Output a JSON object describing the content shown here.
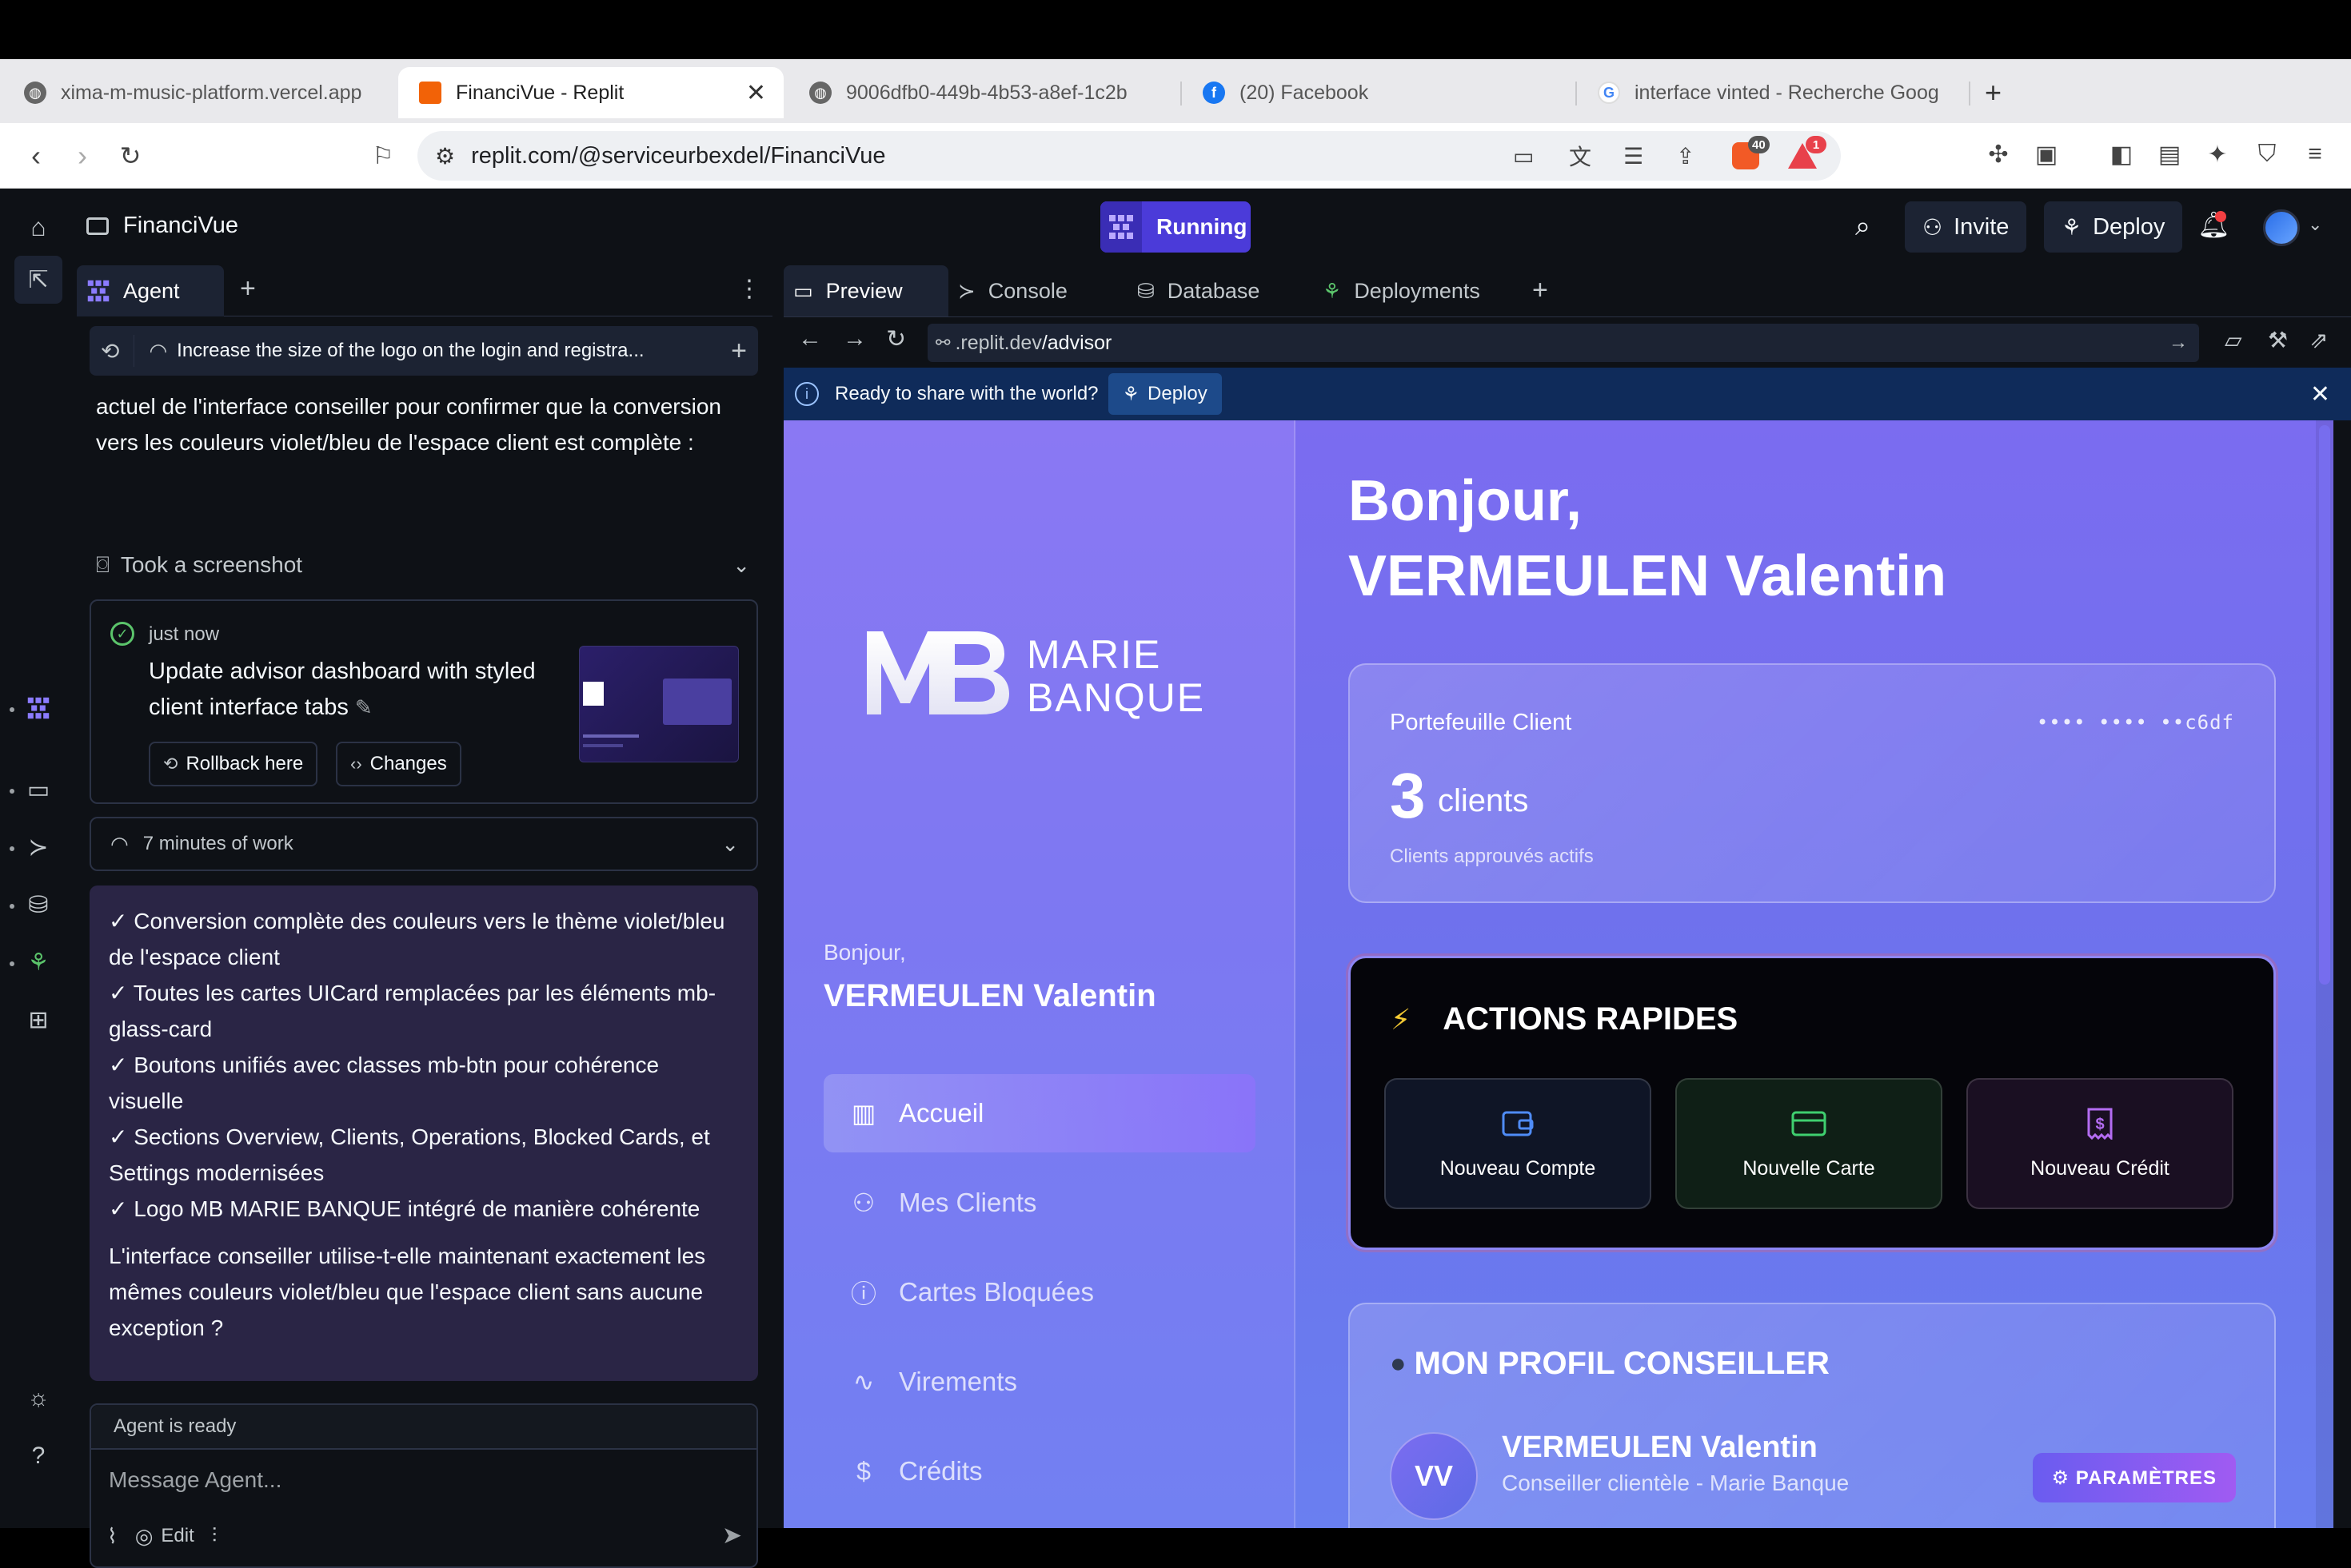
{
  "browser": {
    "tabs": [
      {
        "title": "xima-m-music-platform.vercel.app",
        "icon": "globe-icon"
      },
      {
        "title": "FinanciVue - Replit",
        "icon": "replit-icon"
      },
      {
        "title": "9006dfb0-449b-4b53-a8ef-1c2b",
        "icon": "globe-icon"
      },
      {
        "title": "(20) Facebook",
        "icon": "facebook-icon"
      },
      {
        "title": "interface vinted - Recherche Goog",
        "icon": "google-icon"
      }
    ],
    "url": "replit.com/@serviceurbexdel/FinanciVue",
    "brave_badge": "40",
    "alert_badge": "1",
    "colors": {
      "tabstrip": "#e9e9ec",
      "active_tab": "#ffffff"
    }
  },
  "header": {
    "project_name": "FinanciVue",
    "run_label": "Running",
    "invite_label": "Invite",
    "deploy_label": "Deploy",
    "accent": "#4b3bd9"
  },
  "agent": {
    "tab_label": "Agent",
    "history_text": "Increase the size of the logo on the login and registra...",
    "message_line1": "actuel de l'interface conseiller pour confirmer que la conversion",
    "message_line2": "vers les couleurs violet/bleu de l'espace client est complète :",
    "screenshot_label": "Took a screenshot",
    "checkpoint": {
      "when": "just now",
      "title": "Update advisor dashboard with styled client interface tabs",
      "rollback_label": "Rollback here",
      "changes_label": "Changes"
    },
    "work_label": "7 minutes of work",
    "summary": [
      "✓ Conversion complète des couleurs vers le thème violet/bleu de l'espace client",
      "✓ Toutes les cartes UICard remplacées par les éléments mb-glass-card",
      "✓ Boutons unifiés avec classes mb-btn pour cohérence visuelle",
      "✓ Sections Overview, Clients, Operations, Blocked Cards, et Settings modernisées",
      "✓ Logo MB MARIE BANQUE intégré de manière cohérente"
    ],
    "question": "L'interface conseiller utilise-t-elle maintenant exactement les mêmes couleurs violet/bleu que l'espace client sans aucune exception ?",
    "status": "Agent is ready",
    "placeholder": "Message Agent...",
    "edit_label": "Edit"
  },
  "preview": {
    "tabs": [
      "Preview",
      "Console",
      "Database",
      "Deployments"
    ],
    "url_prefix": ".replit.dev",
    "url_path": "/advisor",
    "share_text": "Ready to share with the world?",
    "share_deploy": "Deploy"
  },
  "site": {
    "logo_initials": "MB",
    "logo_line1": "MARIE",
    "logo_line2": "BANQUE",
    "sidebar_greeting": "Bonjour,",
    "sidebar_name": "VERMEULEN Valentin",
    "nav": [
      {
        "label": "Accueil",
        "icon": "bar-chart-icon",
        "active": true
      },
      {
        "label": "Mes Clients",
        "icon": "users-icon",
        "active": false
      },
      {
        "label": "Cartes Bloquées",
        "icon": "alert-circle-icon",
        "active": false
      },
      {
        "label": "Virements",
        "icon": "activity-icon",
        "active": false
      },
      {
        "label": "Crédits",
        "icon": "receipt-icon",
        "active": false
      }
    ],
    "greeting": "Bonjour,",
    "name": "VERMEULEN Valentin",
    "portfolio": {
      "title": "Portefeuille Client",
      "masked": "•••• •••• ••c6df",
      "count": "3",
      "unit": "clients",
      "subtitle": "Clients approuvés actifs"
    },
    "quick_actions": {
      "title": "ACTIONS RAPIDES",
      "items": [
        {
          "label": "Nouveau Compte",
          "icon": "wallet-icon",
          "color": "#4f8cf7"
        },
        {
          "label": "Nouvelle Carte",
          "icon": "credit-card-icon",
          "color": "#3fcf6f"
        },
        {
          "label": "Nouveau Crédit",
          "icon": "receipt-icon",
          "color": "#b46cf2"
        }
      ]
    },
    "profile": {
      "title": "MON PROFIL CONSEILLER",
      "initials": "VV",
      "name": "VERMEULEN Valentin",
      "role": "Conseiller clientèle - Marie Banque",
      "settings_label": "⚙ PARAMÈTRES"
    }
  }
}
